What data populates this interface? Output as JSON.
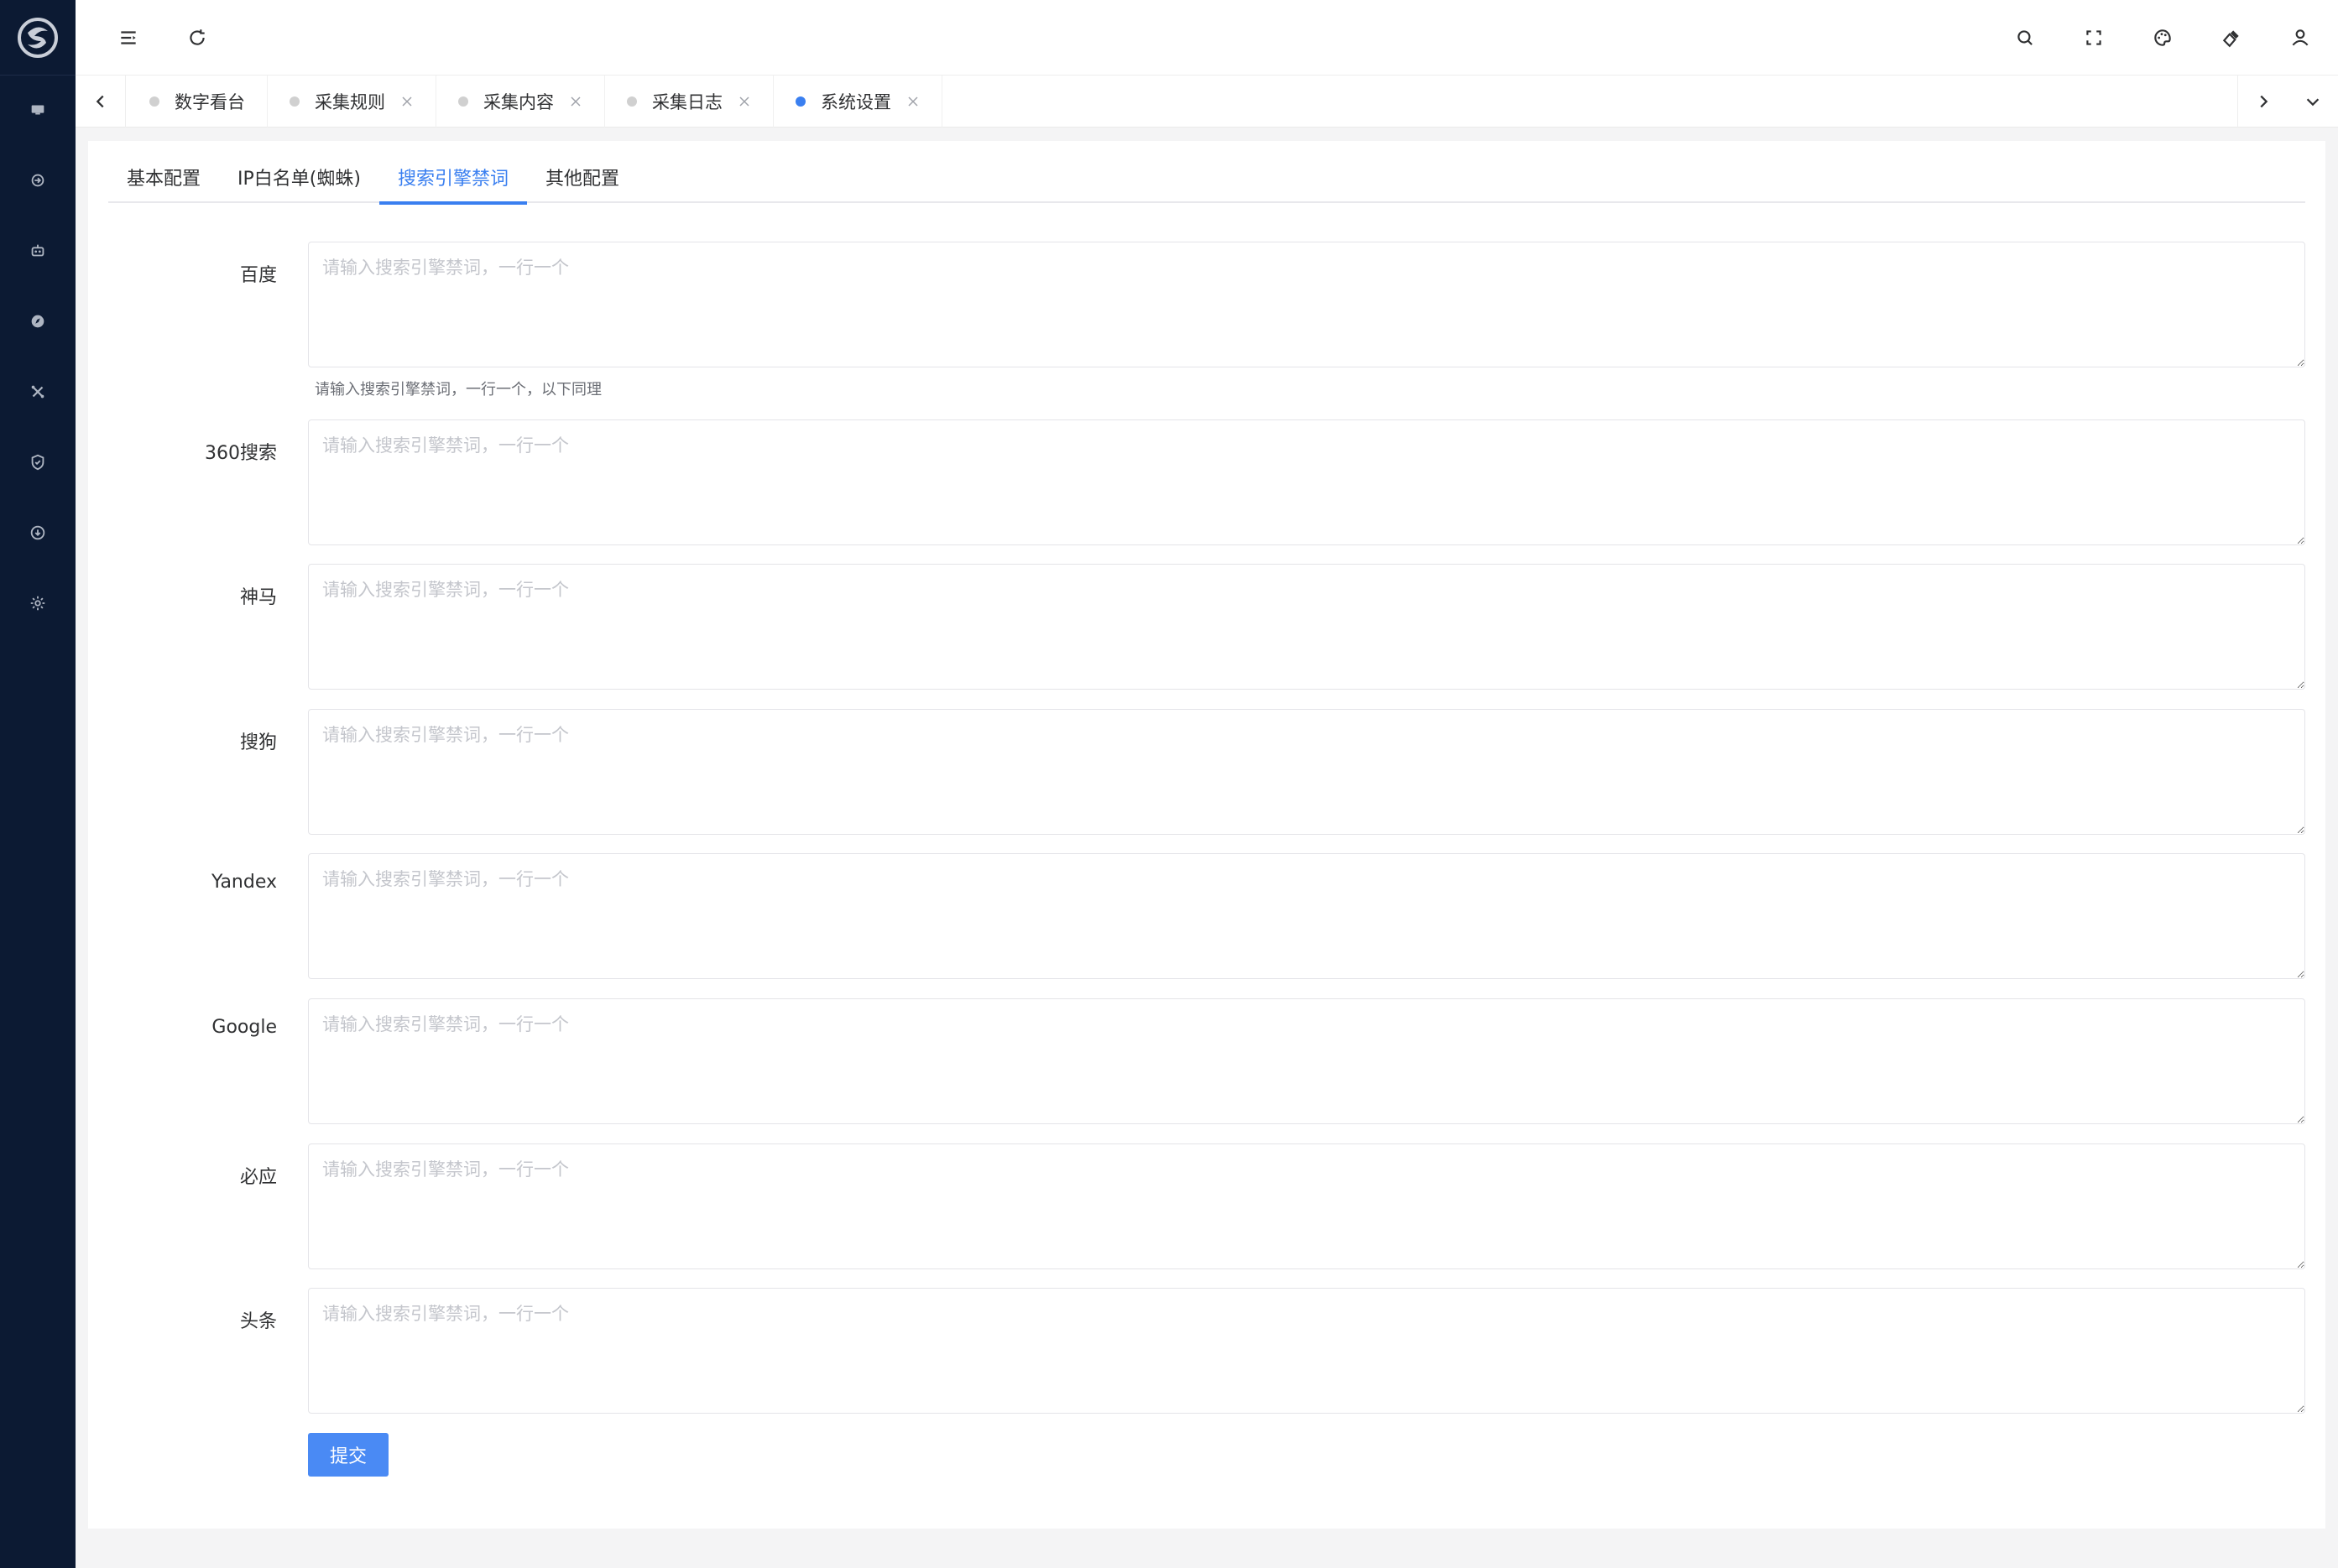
{
  "sidebar": {
    "logo": "app-logo",
    "items": [
      {
        "icon": "monitor-icon"
      },
      {
        "icon": "collect-icon"
      },
      {
        "icon": "robot-icon"
      },
      {
        "icon": "compass-icon"
      },
      {
        "icon": "tools-icon"
      },
      {
        "icon": "shield-icon"
      },
      {
        "icon": "download-icon"
      },
      {
        "icon": "gear-icon"
      }
    ]
  },
  "header": {
    "left_icons": [
      "collapse-menu-icon",
      "refresh-icon"
    ],
    "right_icons": [
      "search-icon",
      "fullscreen-icon",
      "theme-icon",
      "clear-cache-icon",
      "user-icon"
    ]
  },
  "tabs": [
    {
      "label": "数字看台",
      "closable": false,
      "active": false
    },
    {
      "label": "采集规则",
      "closable": true,
      "active": false
    },
    {
      "label": "采集内容",
      "closable": true,
      "active": false
    },
    {
      "label": "采集日志",
      "closable": true,
      "active": false
    },
    {
      "label": "系统设置",
      "closable": true,
      "active": true
    }
  ],
  "subtabs": [
    {
      "label": "基本配置",
      "active": false
    },
    {
      "label": "IP白名单(蜘蛛)",
      "active": false
    },
    {
      "label": "搜索引擎禁词",
      "active": true
    },
    {
      "label": "其他配置",
      "active": false
    }
  ],
  "form": {
    "placeholder": "请输入搜索引擎禁词，一行一个",
    "help": "请输入搜索引擎禁词，一行一个，以下同理",
    "fields": [
      {
        "label": "百度",
        "value": ""
      },
      {
        "label": "360搜索",
        "value": ""
      },
      {
        "label": "神马",
        "value": ""
      },
      {
        "label": "搜狗",
        "value": ""
      },
      {
        "label": "Yandex",
        "value": ""
      },
      {
        "label": "Google",
        "value": ""
      },
      {
        "label": "必应",
        "value": ""
      },
      {
        "label": "头条",
        "value": ""
      }
    ],
    "submit_label": "提交"
  },
  "colors": {
    "sidebar_bg": "#0c1a33",
    "accent": "#3a7ff0",
    "button": "#4a8af4"
  }
}
